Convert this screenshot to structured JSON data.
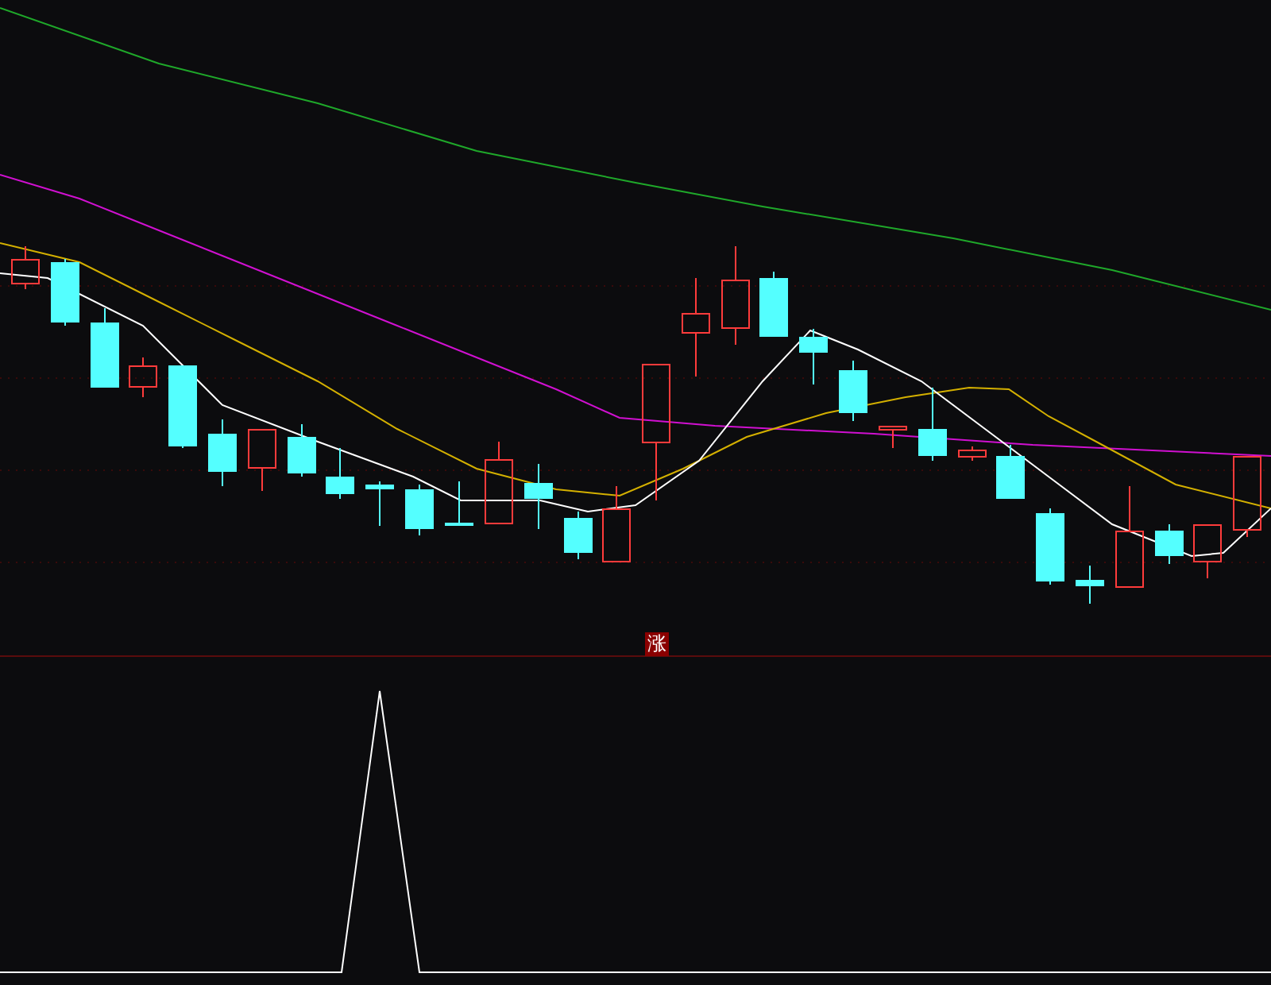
{
  "signal_marker": {
    "text": "涨"
  }
}
